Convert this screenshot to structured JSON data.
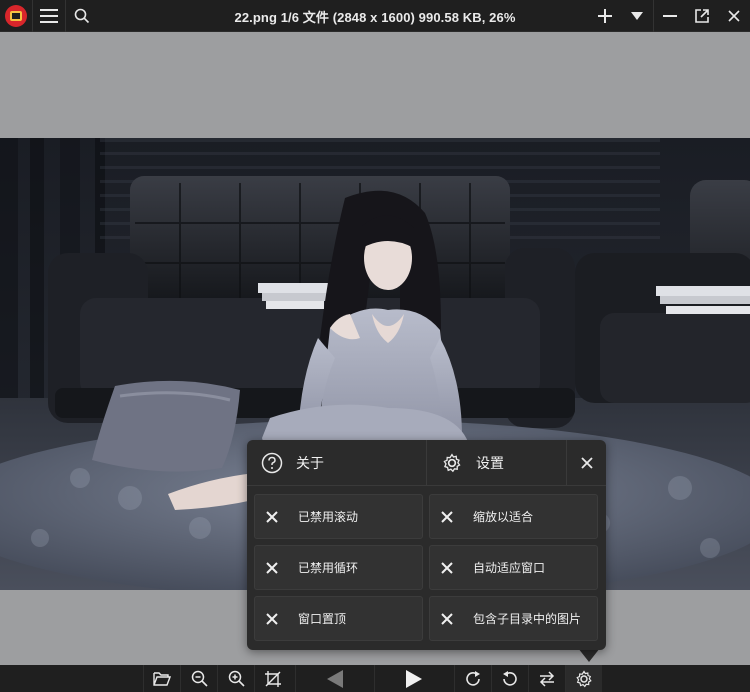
{
  "window": {
    "title": "22.png 1/6 文件 (2848 x 1600) 990.58 KB, 26%"
  },
  "titlebar": {
    "icons": [
      "app-logo-icon",
      "menu-icon",
      "search-icon",
      "plus-icon",
      "dropdown-icon",
      "minimize-icon",
      "open-external-icon",
      "close-icon"
    ]
  },
  "toolbar": {
    "icons": [
      "folder-open-icon",
      "zoom-out-icon",
      "zoom-in-icon",
      "no-crop-icon",
      "previous-icon",
      "next-icon",
      "rotate-right-icon",
      "rotate-left-icon",
      "swap-icon",
      "gear-icon"
    ]
  },
  "popup": {
    "about_label": "关于",
    "settings_label": "设置",
    "options": [
      {
        "label": "已禁用滚动"
      },
      {
        "label": "缩放以适合"
      },
      {
        "label": "已禁用循环"
      },
      {
        "label": "自动适应窗口"
      },
      {
        "label": "窗口置顶"
      },
      {
        "label": "包含子目录中的图片"
      }
    ]
  },
  "colors": {
    "chrome": "#1f1f1f",
    "viewport": "#9d9ea0",
    "popup": "#2b2b2b",
    "option": "#323232"
  }
}
